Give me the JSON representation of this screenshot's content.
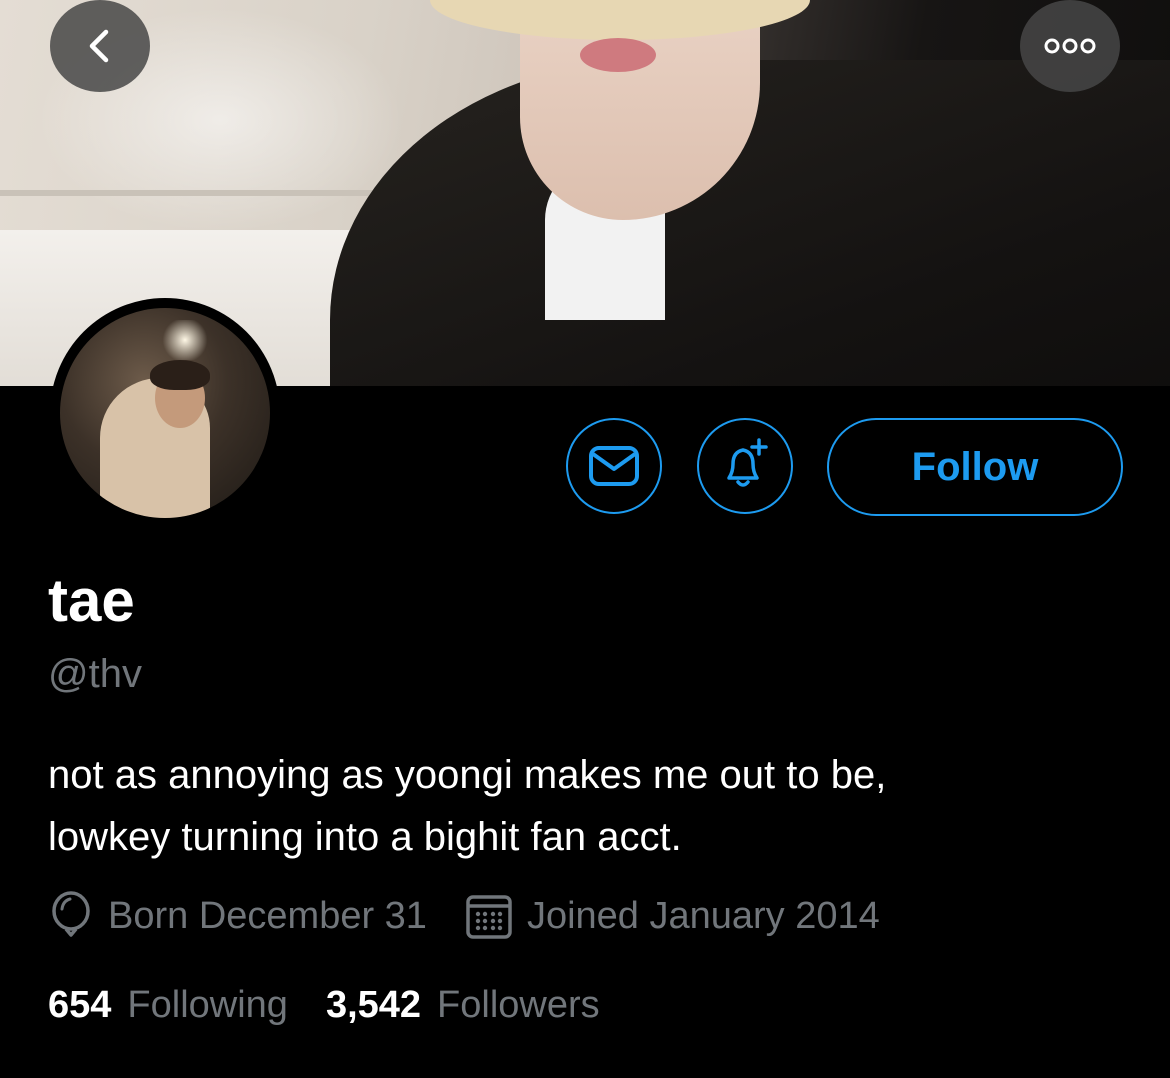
{
  "profile": {
    "display_name": "tae",
    "handle": "@thv",
    "bio_line_1": "not as annoying as yoongi makes me out to be,",
    "bio_line_2": "lowkey turning into a bighit fan acct.",
    "born": "Born December 31",
    "joined": "Joined January 2014"
  },
  "stats": {
    "following_count": "654",
    "following_label": "Following",
    "followers_count": "3,542",
    "followers_label": "Followers"
  },
  "actions": {
    "follow_label": "Follow"
  },
  "colors": {
    "accent": "#1d9bf0",
    "muted_text": "#71767b",
    "background": "#000000"
  },
  "icons": {
    "back": "chevron-left-icon",
    "more": "more-horizontal-icon",
    "message": "mail-icon",
    "notify": "bell-plus-icon",
    "birthday": "balloon-icon",
    "joined": "calendar-icon"
  }
}
